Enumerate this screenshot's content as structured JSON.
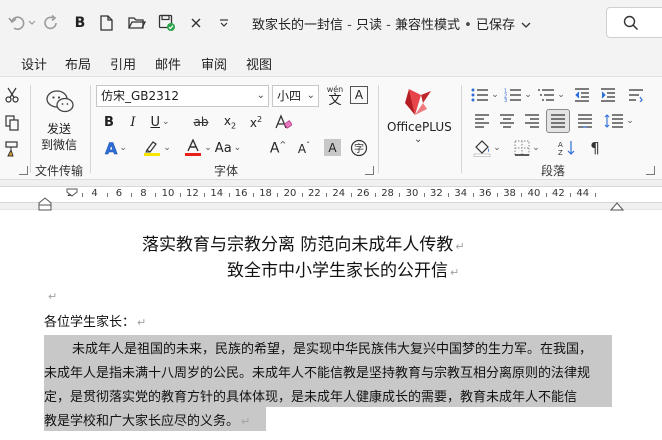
{
  "titlebar": {
    "document_name": "致家长的一封信",
    "mode": "只读",
    "compat": "兼容性模式",
    "saved": "已保存",
    "separator": "-",
    "dot": "•"
  },
  "tabs": [
    "设计",
    "布局",
    "引用",
    "邮件",
    "审阅",
    "视图"
  ],
  "ribbon": {
    "wechat_send_label": "发送",
    "wechat_send_label2": "到微信",
    "group_file_transfer": "文件传输",
    "font_name": "仿宋_GB2312",
    "font_size": "小四",
    "wen_label": "wén",
    "wen_char": "文",
    "group_font": "字体",
    "officeplus_label": "OfficePLUS",
    "group_paragraph": "段落"
  },
  "ruler": {
    "numbers": [
      "2",
      "4",
      "6",
      "8",
      "10",
      "12",
      "14",
      "16",
      "18",
      "20",
      "22",
      "24",
      "26",
      "28",
      "30",
      "32",
      "34",
      "36",
      "38",
      "40",
      "42",
      "44"
    ]
  },
  "document": {
    "title_line1": "落实教育与宗教分离 防范向未成年人传教",
    "title_line2": "致全市中小学生家长的公开信",
    "salutation": "各位学生家长：",
    "paragraph_lines": [
      "未成年人是祖国的未来，民族的希望，是实现中华民族伟大复兴中国梦的生力军。在我国，",
      "未成年人是指未满十八周岁的公民。未成年人不能信教是坚持教育与宗教互相分离原则的法律规",
      "定，是贯彻落实党的教育方针的具体体现，是未成年人健康成长的需要，教育未成年人不能信",
      "教是学校和广大家长应尽的义务。"
    ],
    "paragraph_mark": "↵",
    "empty_mark": "↵"
  },
  "colors": {
    "highlight": "#c8c8c8",
    "font_color_red": "#e8211b",
    "highlighter_yellow": "#f5e600",
    "text_effect_blue": "#2e6fd8",
    "officeplus_red": "#d8282e"
  }
}
